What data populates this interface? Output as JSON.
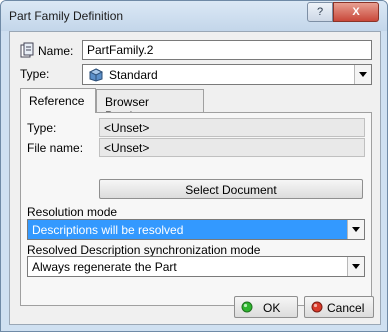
{
  "window": {
    "title": "Part Family Definition",
    "help_button": "?",
    "close_button": "X"
  },
  "name": {
    "label": "Name:",
    "value": "PartFamily.2"
  },
  "type": {
    "label": "Type:",
    "value": "Standard"
  },
  "tabs": [
    {
      "label": "Reference",
      "active": true
    },
    {
      "label": "Browser Preview",
      "active": false
    }
  ],
  "reference": {
    "type_label": "Type:",
    "type_value": "<Unset>",
    "file_label": "File name:",
    "file_value": "<Unset>",
    "select_button": "Select Document"
  },
  "resolution": {
    "label": "Resolution mode",
    "value": "Descriptions will be resolved"
  },
  "sync": {
    "label": "Resolved Description synchronization mode",
    "value": "Always regenerate the Part"
  },
  "footer": {
    "ok_label": "OK",
    "cancel_label": "Cancel"
  },
  "colors": {
    "ok_icon": "#2fb52f",
    "cancel_icon": "#d83a2a",
    "selection": "#3399ff"
  }
}
